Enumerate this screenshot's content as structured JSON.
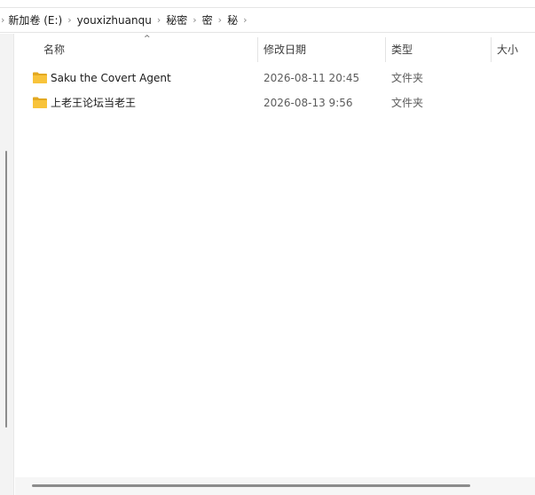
{
  "breadcrumb": {
    "items": [
      "新加卷 (E:)",
      "youxizhuanqu",
      "秘密",
      "密",
      "秘"
    ],
    "separator": "›"
  },
  "columns": {
    "name": "名称",
    "date": "修改日期",
    "type": "类型",
    "size": "大小",
    "sort_indicator": "^"
  },
  "files": [
    {
      "name": "Saku the Covert Agent",
      "date": "2026-08-11 20:45",
      "type": "文件夹",
      "icon": "folder-icon"
    },
    {
      "name": "上老王论坛当老王",
      "date": "2026-08-13 9:56",
      "type": "文件夹",
      "icon": "folder-icon"
    }
  ],
  "colors": {
    "folder": "#f8c33a",
    "folder_dark": "#e3a921",
    "text": "#1a1a1a",
    "meta_text": "#5c5c5c"
  }
}
